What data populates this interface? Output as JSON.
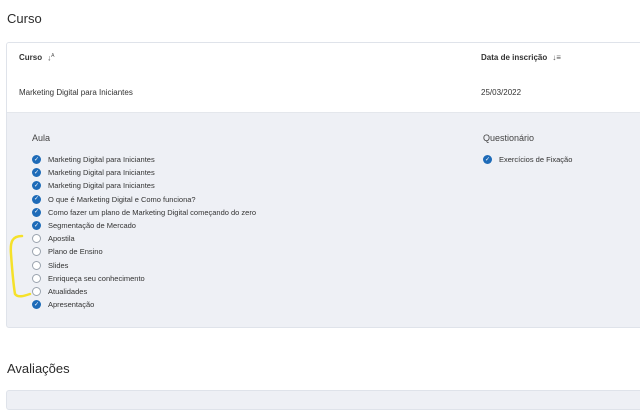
{
  "sections": {
    "course_title": "Curso",
    "ratings_title": "Avaliações"
  },
  "table": {
    "col_course": "Curso",
    "col_date": "Data de inscrição",
    "row": {
      "course": "Marketing Digital para Iniciantes",
      "date": "25/03/2022"
    }
  },
  "detail": {
    "lessons_header": "Aula",
    "quiz_header": "Questionário",
    "lessons": [
      {
        "label": "Marketing Digital para Iniciantes",
        "done": true
      },
      {
        "label": "Marketing Digital para Iniciantes",
        "done": true
      },
      {
        "label": "Marketing Digital para Iniciantes",
        "done": true
      },
      {
        "label": "O que é Marketing Digital e Como funciona?",
        "done": true
      },
      {
        "label": "Como fazer um plano de Marketing Digital começando do zero",
        "done": true
      },
      {
        "label": "Segmentação de Mercado",
        "done": true
      },
      {
        "label": "Apostila",
        "done": false
      },
      {
        "label": "Plano de Ensino",
        "done": false
      },
      {
        "label": "Slides",
        "done": false
      },
      {
        "label": "Enriqueça seu conhecimento",
        "done": false
      },
      {
        "label": "Atualidades",
        "done": false
      },
      {
        "label": "Apresentação",
        "done": true
      }
    ],
    "quizzes": [
      {
        "label": "Exercícios de Fixação",
        "done": true
      }
    ]
  },
  "colors": {
    "check_done": "#1e6bb8",
    "annotation": "#f5e12a",
    "panel_bg": "#eef0f5"
  },
  "icons": {
    "sort_course": "sort-ascending-icon",
    "sort_date": "sort-descending-icon",
    "done": "check-circle-icon",
    "todo": "empty-circle-icon"
  }
}
